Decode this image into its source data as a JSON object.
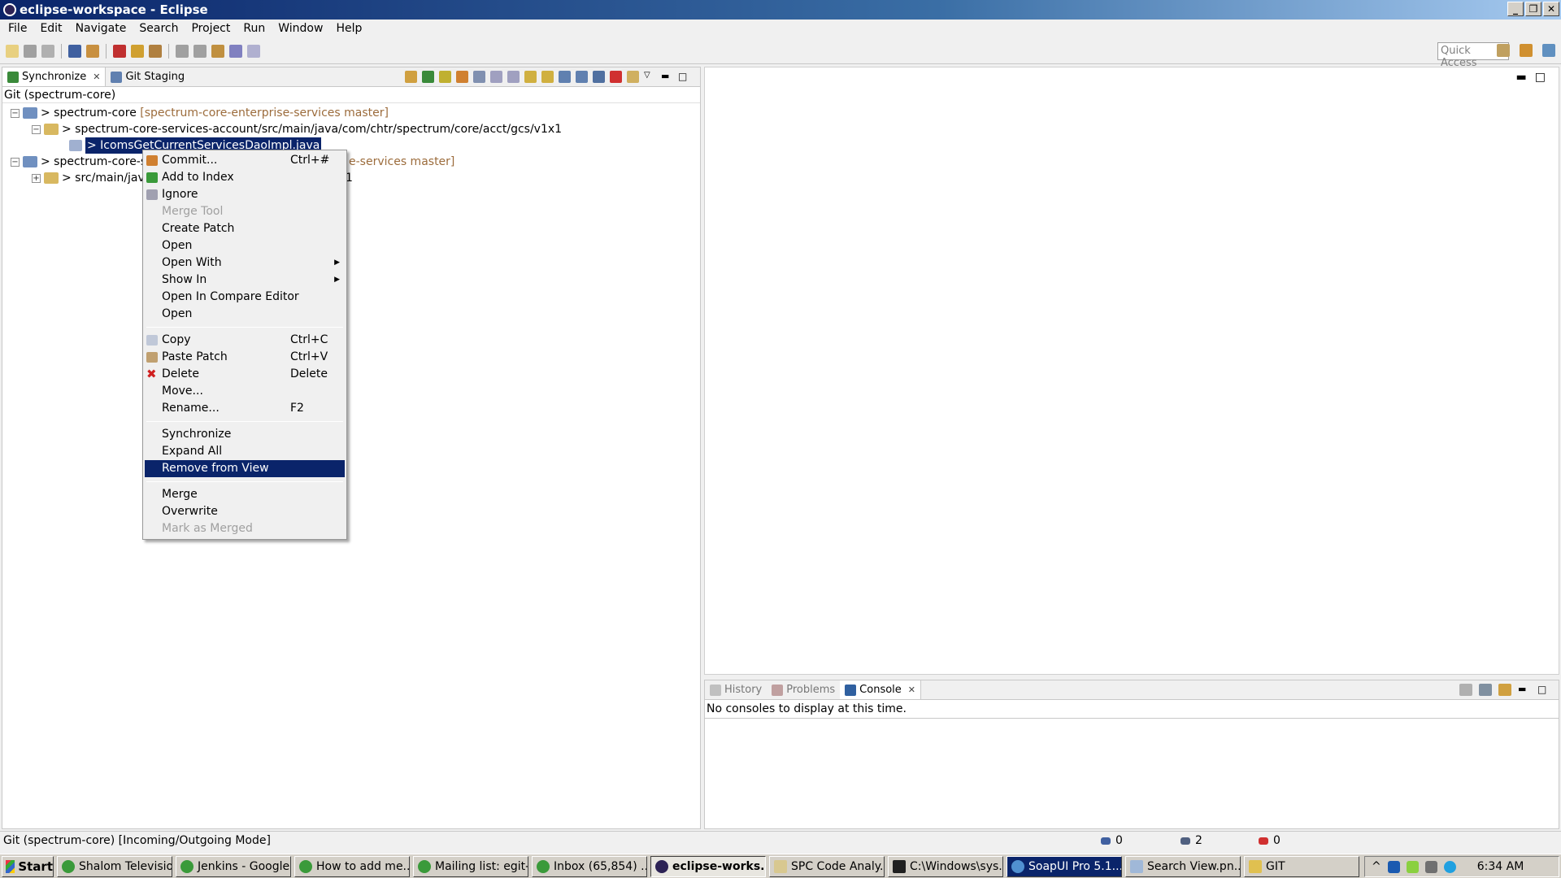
{
  "window": {
    "title": "eclipse-workspace - Eclipse",
    "minimize": "_",
    "restore": "❐",
    "close": "✕"
  },
  "menubar": [
    "File",
    "Edit",
    "Navigate",
    "Search",
    "Project",
    "Run",
    "Window",
    "Help"
  ],
  "toolbar": {
    "quick_access_placeholder": "Quick Access"
  },
  "left_view": {
    "tabs": [
      {
        "label": "Synchronize",
        "active": true
      },
      {
        "label": "Git Staging",
        "active": false
      }
    ],
    "header": "Git (spectrum-core)",
    "tree": {
      "row1": {
        "expander": "−",
        "name": "> spectrum-core",
        "decoration": "[spectrum-core-enterprise-services master]"
      },
      "row2": {
        "expander": "−",
        "name": "> spectrum-core-services-account/src/main/java/com/chtr/spectrum/core/acct/gcs/v1x1"
      },
      "row3": {
        "name": "> IcomsGetCurrentServicesDaoImpl.java"
      },
      "row4": {
        "expander": "−",
        "name": "> spectrum-core-s",
        "decoration": "e-services master]"
      },
      "row5": {
        "expander": "+",
        "name": "> src/main/jav",
        "suffix": "1"
      }
    }
  },
  "context_menu": {
    "commit": {
      "label": "Commit...",
      "shortcut": "Ctrl+#"
    },
    "add_to_index": {
      "label": "Add to Index"
    },
    "ignore": {
      "label": "Ignore"
    },
    "merge_tool": {
      "label": "Merge Tool"
    },
    "create_patch": {
      "label": "Create Patch"
    },
    "open": {
      "label": "Open"
    },
    "open_with": {
      "label": "Open With"
    },
    "show_in": {
      "label": "Show In"
    },
    "open_compare": {
      "label": "Open In Compare Editor"
    },
    "open2": {
      "label": "Open"
    },
    "copy": {
      "label": "Copy",
      "shortcut": "Ctrl+C"
    },
    "paste_patch": {
      "label": "Paste Patch",
      "shortcut": "Ctrl+V"
    },
    "delete": {
      "label": "Delete",
      "shortcut": "Delete"
    },
    "move": {
      "label": "Move..."
    },
    "rename": {
      "label": "Rename...",
      "shortcut": "F2"
    },
    "synchronize": {
      "label": "Synchronize"
    },
    "expand_all": {
      "label": "Expand All"
    },
    "remove_from_view": {
      "label": "Remove from View"
    },
    "merge": {
      "label": "Merge"
    },
    "overwrite": {
      "label": "Overwrite"
    },
    "mark_as_merged": {
      "label": "Mark as Merged"
    },
    "submenu_arrow": "▶"
  },
  "console_view": {
    "tabs": [
      {
        "label": "History"
      },
      {
        "label": "Problems"
      },
      {
        "label": "Console",
        "active": true
      }
    ],
    "message": "No consoles to display at this time."
  },
  "statusbar": {
    "text": "Git (spectrum-core) [Incoming/Outgoing Mode]",
    "incoming": "0",
    "outgoing": "2",
    "conflicts": "0"
  },
  "taskbar": {
    "start": "Start",
    "buttons": [
      {
        "label": "Shalom Televisio..."
      },
      {
        "label": "Jenkins - Google..."
      },
      {
        "label": "How to add me..."
      },
      {
        "label": "Mailing list: egit-..."
      },
      {
        "label": "Inbox (65,854) ..."
      },
      {
        "label": "eclipse-works...",
        "active": true
      },
      {
        "label": "SPC Code Analy..."
      },
      {
        "label": "C:\\Windows\\sys..."
      },
      {
        "label": "SoapUI Pro 5.1...."
      },
      {
        "label": "Search View.pn..."
      },
      {
        "label": "GIT"
      }
    ],
    "clock": "6:34 AM",
    "tray_arrow": "^"
  },
  "colors": {
    "selection": "#0a246a",
    "decoration": "#9c6c3c",
    "title_start": "#0a246a"
  }
}
